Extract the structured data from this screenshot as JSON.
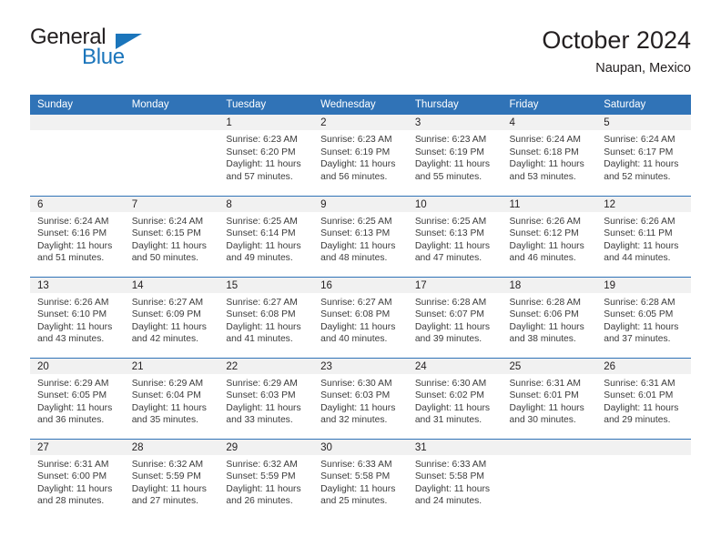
{
  "brand": {
    "line1": "General",
    "line2": "Blue",
    "triangle_color": "#1b75bb"
  },
  "header": {
    "title": "October 2024",
    "subtitle": "Naupan, Mexico"
  },
  "colors": {
    "header_blue": "#3073b7",
    "daynum_band": "#f1f1f1",
    "brand_blue": "#1b75bb",
    "text": "#231f20"
  },
  "weekday_headers": [
    "Sunday",
    "Monday",
    "Tuesday",
    "Wednesday",
    "Thursday",
    "Friday",
    "Saturday"
  ],
  "weeks": [
    [
      {
        "day": "",
        "sunrise": "",
        "sunset": "",
        "daylight_line1": "",
        "daylight_line2": ""
      },
      {
        "day": "",
        "sunrise": "",
        "sunset": "",
        "daylight_line1": "",
        "daylight_line2": ""
      },
      {
        "day": "1",
        "sunrise": "Sunrise: 6:23 AM",
        "sunset": "Sunset: 6:20 PM",
        "daylight_line1": "Daylight: 11 hours",
        "daylight_line2": "and 57 minutes."
      },
      {
        "day": "2",
        "sunrise": "Sunrise: 6:23 AM",
        "sunset": "Sunset: 6:19 PM",
        "daylight_line1": "Daylight: 11 hours",
        "daylight_line2": "and 56 minutes."
      },
      {
        "day": "3",
        "sunrise": "Sunrise: 6:23 AM",
        "sunset": "Sunset: 6:19 PM",
        "daylight_line1": "Daylight: 11 hours",
        "daylight_line2": "and 55 minutes."
      },
      {
        "day": "4",
        "sunrise": "Sunrise: 6:24 AM",
        "sunset": "Sunset: 6:18 PM",
        "daylight_line1": "Daylight: 11 hours",
        "daylight_line2": "and 53 minutes."
      },
      {
        "day": "5",
        "sunrise": "Sunrise: 6:24 AM",
        "sunset": "Sunset: 6:17 PM",
        "daylight_line1": "Daylight: 11 hours",
        "daylight_line2": "and 52 minutes."
      }
    ],
    [
      {
        "day": "6",
        "sunrise": "Sunrise: 6:24 AM",
        "sunset": "Sunset: 6:16 PM",
        "daylight_line1": "Daylight: 11 hours",
        "daylight_line2": "and 51 minutes."
      },
      {
        "day": "7",
        "sunrise": "Sunrise: 6:24 AM",
        "sunset": "Sunset: 6:15 PM",
        "daylight_line1": "Daylight: 11 hours",
        "daylight_line2": "and 50 minutes."
      },
      {
        "day": "8",
        "sunrise": "Sunrise: 6:25 AM",
        "sunset": "Sunset: 6:14 PM",
        "daylight_line1": "Daylight: 11 hours",
        "daylight_line2": "and 49 minutes."
      },
      {
        "day": "9",
        "sunrise": "Sunrise: 6:25 AM",
        "sunset": "Sunset: 6:13 PM",
        "daylight_line1": "Daylight: 11 hours",
        "daylight_line2": "and 48 minutes."
      },
      {
        "day": "10",
        "sunrise": "Sunrise: 6:25 AM",
        "sunset": "Sunset: 6:13 PM",
        "daylight_line1": "Daylight: 11 hours",
        "daylight_line2": "and 47 minutes."
      },
      {
        "day": "11",
        "sunrise": "Sunrise: 6:26 AM",
        "sunset": "Sunset: 6:12 PM",
        "daylight_line1": "Daylight: 11 hours",
        "daylight_line2": "and 46 minutes."
      },
      {
        "day": "12",
        "sunrise": "Sunrise: 6:26 AM",
        "sunset": "Sunset: 6:11 PM",
        "daylight_line1": "Daylight: 11 hours",
        "daylight_line2": "and 44 minutes."
      }
    ],
    [
      {
        "day": "13",
        "sunrise": "Sunrise: 6:26 AM",
        "sunset": "Sunset: 6:10 PM",
        "daylight_line1": "Daylight: 11 hours",
        "daylight_line2": "and 43 minutes."
      },
      {
        "day": "14",
        "sunrise": "Sunrise: 6:27 AM",
        "sunset": "Sunset: 6:09 PM",
        "daylight_line1": "Daylight: 11 hours",
        "daylight_line2": "and 42 minutes."
      },
      {
        "day": "15",
        "sunrise": "Sunrise: 6:27 AM",
        "sunset": "Sunset: 6:08 PM",
        "daylight_line1": "Daylight: 11 hours",
        "daylight_line2": "and 41 minutes."
      },
      {
        "day": "16",
        "sunrise": "Sunrise: 6:27 AM",
        "sunset": "Sunset: 6:08 PM",
        "daylight_line1": "Daylight: 11 hours",
        "daylight_line2": "and 40 minutes."
      },
      {
        "day": "17",
        "sunrise": "Sunrise: 6:28 AM",
        "sunset": "Sunset: 6:07 PM",
        "daylight_line1": "Daylight: 11 hours",
        "daylight_line2": "and 39 minutes."
      },
      {
        "day": "18",
        "sunrise": "Sunrise: 6:28 AM",
        "sunset": "Sunset: 6:06 PM",
        "daylight_line1": "Daylight: 11 hours",
        "daylight_line2": "and 38 minutes."
      },
      {
        "day": "19",
        "sunrise": "Sunrise: 6:28 AM",
        "sunset": "Sunset: 6:05 PM",
        "daylight_line1": "Daylight: 11 hours",
        "daylight_line2": "and 37 minutes."
      }
    ],
    [
      {
        "day": "20",
        "sunrise": "Sunrise: 6:29 AM",
        "sunset": "Sunset: 6:05 PM",
        "daylight_line1": "Daylight: 11 hours",
        "daylight_line2": "and 36 minutes."
      },
      {
        "day": "21",
        "sunrise": "Sunrise: 6:29 AM",
        "sunset": "Sunset: 6:04 PM",
        "daylight_line1": "Daylight: 11 hours",
        "daylight_line2": "and 35 minutes."
      },
      {
        "day": "22",
        "sunrise": "Sunrise: 6:29 AM",
        "sunset": "Sunset: 6:03 PM",
        "daylight_line1": "Daylight: 11 hours",
        "daylight_line2": "and 33 minutes."
      },
      {
        "day": "23",
        "sunrise": "Sunrise: 6:30 AM",
        "sunset": "Sunset: 6:03 PM",
        "daylight_line1": "Daylight: 11 hours",
        "daylight_line2": "and 32 minutes."
      },
      {
        "day": "24",
        "sunrise": "Sunrise: 6:30 AM",
        "sunset": "Sunset: 6:02 PM",
        "daylight_line1": "Daylight: 11 hours",
        "daylight_line2": "and 31 minutes."
      },
      {
        "day": "25",
        "sunrise": "Sunrise: 6:31 AM",
        "sunset": "Sunset: 6:01 PM",
        "daylight_line1": "Daylight: 11 hours",
        "daylight_line2": "and 30 minutes."
      },
      {
        "day": "26",
        "sunrise": "Sunrise: 6:31 AM",
        "sunset": "Sunset: 6:01 PM",
        "daylight_line1": "Daylight: 11 hours",
        "daylight_line2": "and 29 minutes."
      }
    ],
    [
      {
        "day": "27",
        "sunrise": "Sunrise: 6:31 AM",
        "sunset": "Sunset: 6:00 PM",
        "daylight_line1": "Daylight: 11 hours",
        "daylight_line2": "and 28 minutes."
      },
      {
        "day": "28",
        "sunrise": "Sunrise: 6:32 AM",
        "sunset": "Sunset: 5:59 PM",
        "daylight_line1": "Daylight: 11 hours",
        "daylight_line2": "and 27 minutes."
      },
      {
        "day": "29",
        "sunrise": "Sunrise: 6:32 AM",
        "sunset": "Sunset: 5:59 PM",
        "daylight_line1": "Daylight: 11 hours",
        "daylight_line2": "and 26 minutes."
      },
      {
        "day": "30",
        "sunrise": "Sunrise: 6:33 AM",
        "sunset": "Sunset: 5:58 PM",
        "daylight_line1": "Daylight: 11 hours",
        "daylight_line2": "and 25 minutes."
      },
      {
        "day": "31",
        "sunrise": "Sunrise: 6:33 AM",
        "sunset": "Sunset: 5:58 PM",
        "daylight_line1": "Daylight: 11 hours",
        "daylight_line2": "and 24 minutes."
      },
      {
        "day": "",
        "sunrise": "",
        "sunset": "",
        "daylight_line1": "",
        "daylight_line2": ""
      },
      {
        "day": "",
        "sunrise": "",
        "sunset": "",
        "daylight_line1": "",
        "daylight_line2": ""
      }
    ]
  ]
}
